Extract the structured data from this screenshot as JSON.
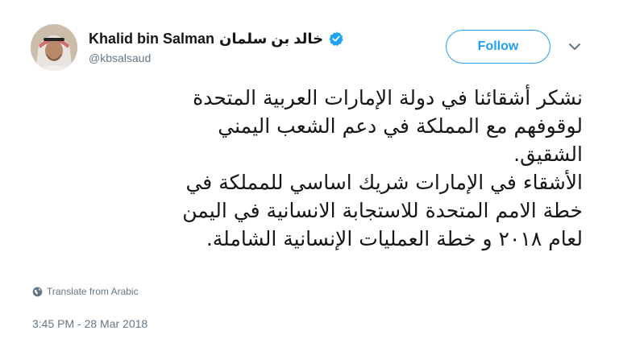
{
  "author": {
    "display_name": "Khalid bin Salman",
    "display_name_ar": "خالد بن سلمان",
    "handle": "@kbsalsaud",
    "verified": true,
    "avatar_icon": "avatar-photo"
  },
  "actions": {
    "follow_label": "Follow",
    "menu_icon": "chevron-down-icon"
  },
  "tweet": {
    "lines": [
      "نشكر أشقائنا في دولة الإمارات العربية المتحدة",
      "لوقوفهم مع المملكة في دعم الشعب اليمني",
      "الشقيق.",
      "الأشقاء في الإمارات شريك اساسي للمملكة في",
      "خطة الامم المتحدة للاستجابة الانسانية في اليمن",
      "لعام ٢٠١٨ و خطة العمليات الإنسانية الشاملة."
    ],
    "translate_label": "Translate from Arabic",
    "timestamp": "3:45 PM - 28 Mar 2018"
  },
  "colors": {
    "accent": "#1da1f2",
    "text": "#14171a",
    "muted": "#657786"
  }
}
